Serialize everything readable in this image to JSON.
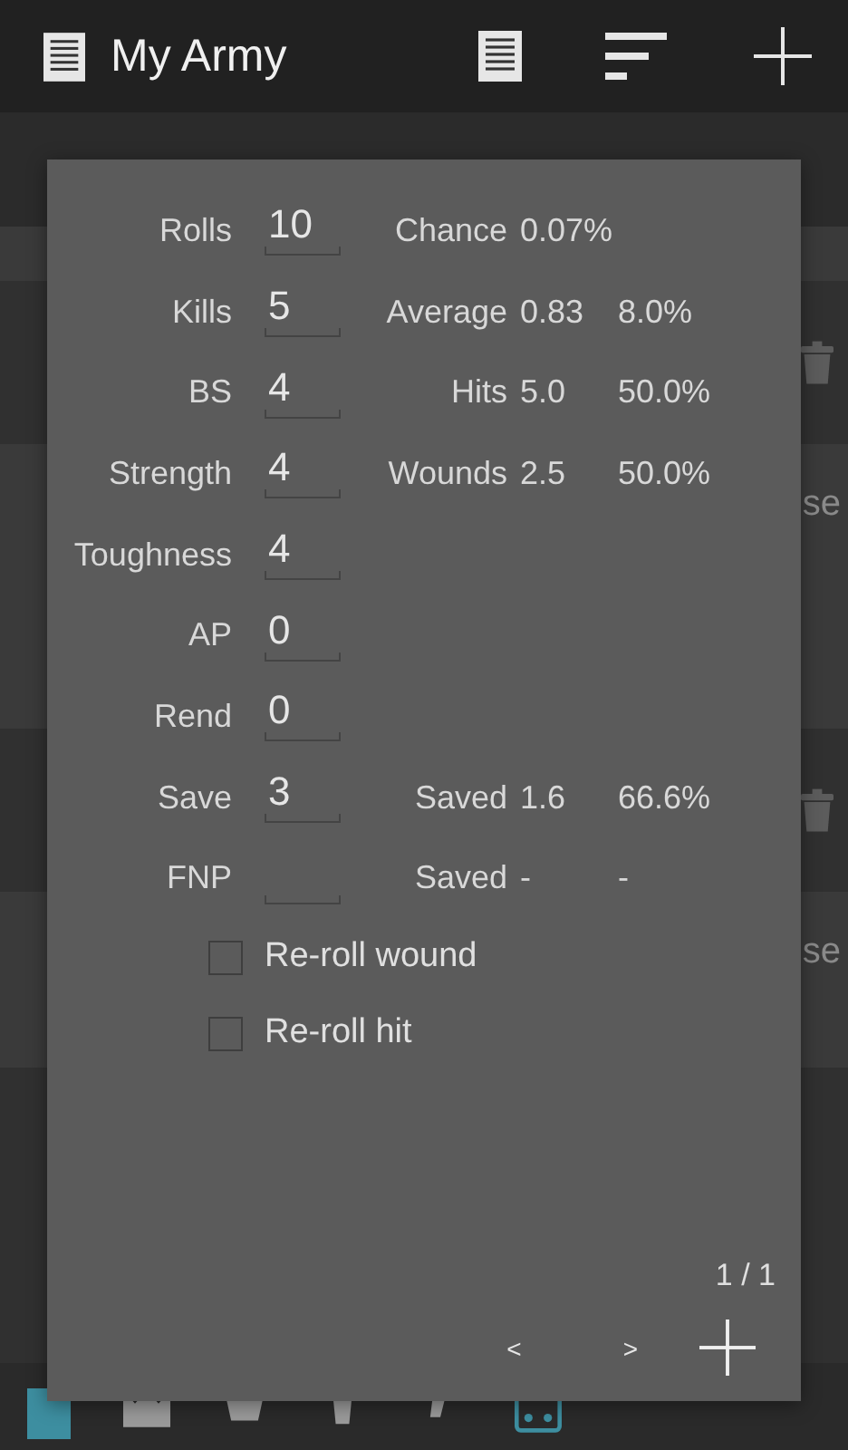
{
  "app_bar": {
    "title": "My Army"
  },
  "list": [
    {
      "kind": "header"
    },
    {
      "kind": "band"
    },
    {
      "kind": "trash"
    },
    {
      "kind": "text",
      "text": "se"
    },
    {
      "kind": "band"
    },
    {
      "kind": "band"
    },
    {
      "kind": "band"
    },
    {
      "kind": "trash"
    },
    {
      "kind": "text",
      "text": "se"
    },
    {
      "kind": "band"
    }
  ],
  "bottom_tabs": [
    {
      "selected": true
    },
    {
      "selected": false
    },
    {
      "selected": false
    },
    {
      "selected": false
    },
    {
      "selected": false
    },
    {
      "selected": true
    }
  ],
  "dialog": {
    "inputs": [
      {
        "label": "Rolls",
        "value": "10",
        "result_label": "Chance",
        "result_value": "0.07%"
      },
      {
        "label": "Kills",
        "value": "5",
        "result_label": "Average",
        "result_value": "0.83",
        "percent": "8.0%"
      },
      {
        "label": "BS",
        "value": "4",
        "result_label": "Hits",
        "result_value": "5.0",
        "percent": "50.0%"
      },
      {
        "label": "Strength",
        "value": "4",
        "result_label": "Wounds",
        "result_value": "2.5",
        "percent": "50.0%"
      },
      {
        "label": "Toughness",
        "value": "4"
      },
      {
        "label": "AP",
        "value": "0"
      },
      {
        "label": "Rend",
        "value": "0"
      },
      {
        "label": "Save",
        "value": "3",
        "result_label": "Saved",
        "result_value": "1.6",
        "percent": "66.6%"
      },
      {
        "label": "FNP",
        "result_label": "Saved",
        "result_value": "-",
        "percent": "-"
      }
    ],
    "checkboxes": [
      {
        "label": "Re-roll wound",
        "checked": false
      },
      {
        "label": "Re-roll hit",
        "checked": false
      }
    ],
    "page": "1 / 1",
    "prev": "<",
    "next": ">"
  }
}
